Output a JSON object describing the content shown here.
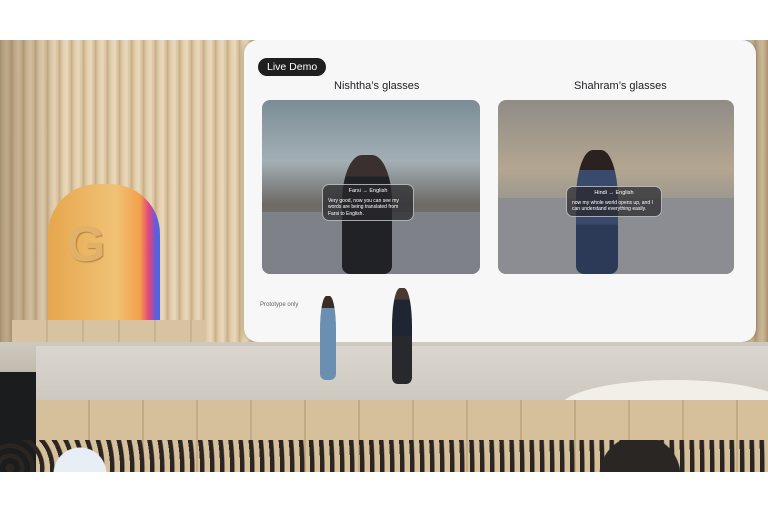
{
  "slide": {
    "badge": "Live Demo",
    "left_title": "Nishtha’s glasses",
    "right_title": "Shahram’s glasses",
    "left_bubble": {
      "language": "Farsi → English",
      "text": "Very good, now you can see my words are being translated from Farsi to English."
    },
    "right_bubble": {
      "language": "Hindi → English",
      "text": "now my whole world opens up, and I can understand everything easily."
    },
    "footer": "Prototype only"
  },
  "colors": {
    "badge_bg": "#1f1f1f",
    "screen_bg": "#f7f7f8",
    "wood": "#d9c4a0",
    "g_gradient": [
      "#f3a14a",
      "#e2457c",
      "#6b5ad6",
      "#3e6fe0"
    ]
  },
  "icons": {
    "logo": "google-g-logo"
  }
}
